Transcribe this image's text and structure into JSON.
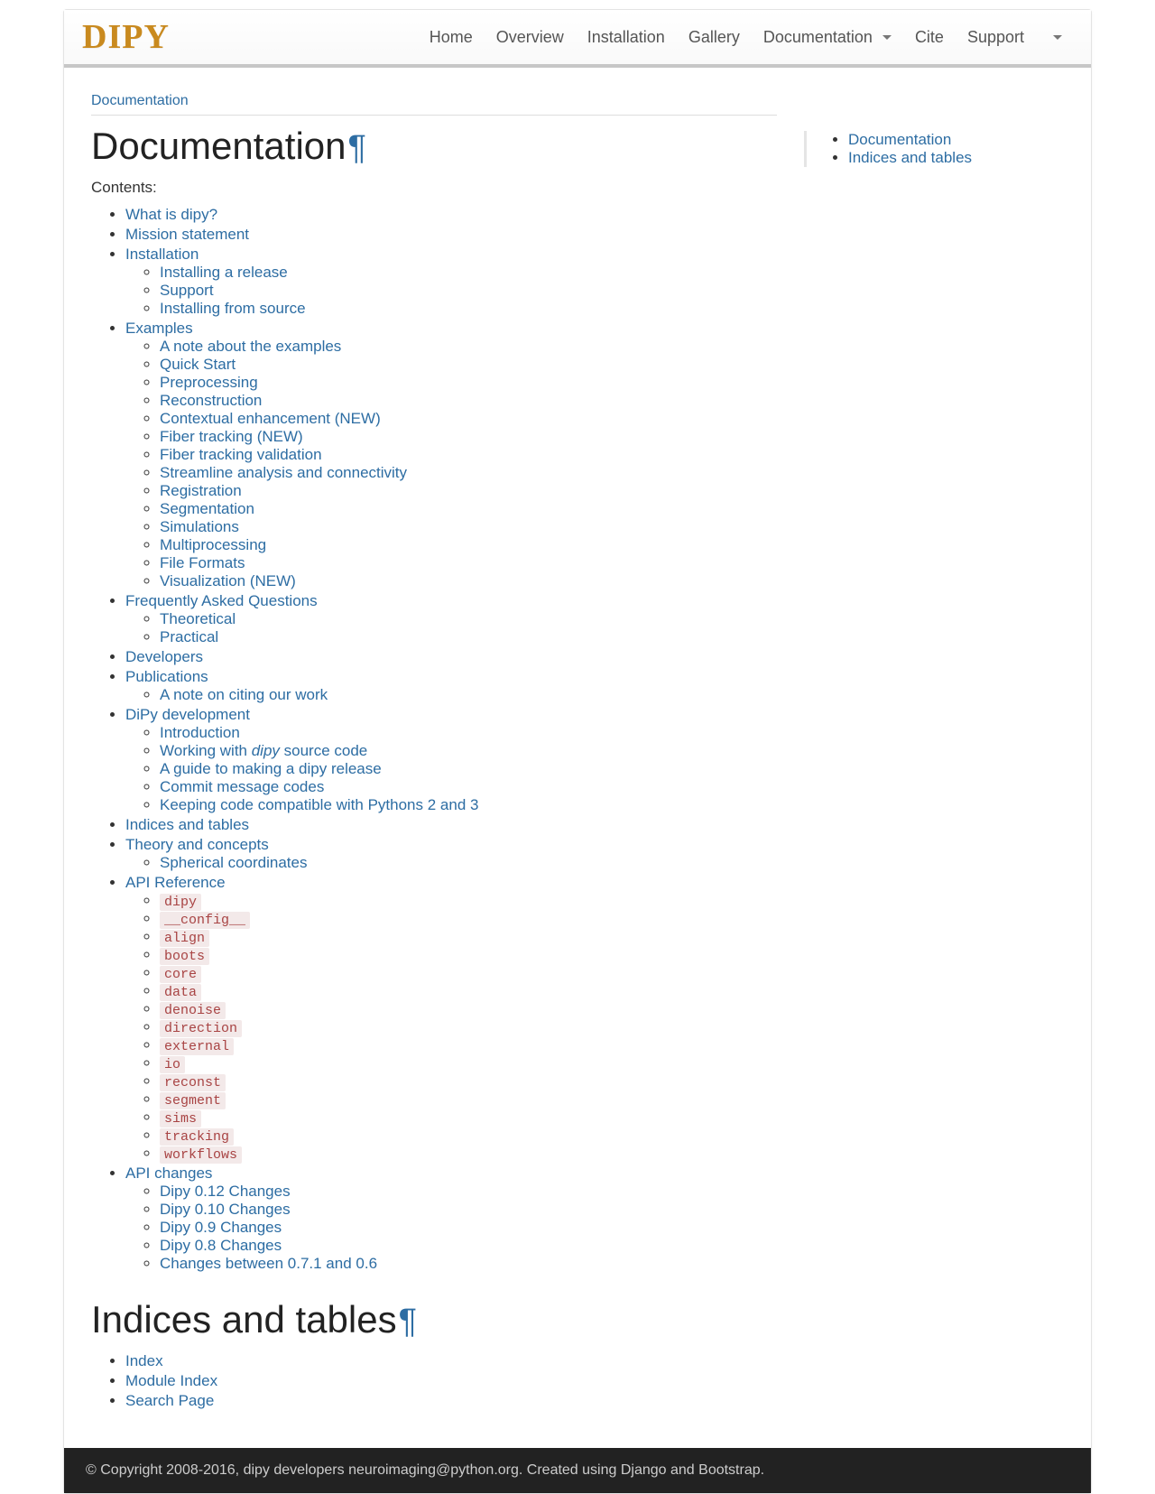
{
  "brand": "DIPY",
  "nav": {
    "home": "Home",
    "overview": "Overview",
    "installation": "Installation",
    "gallery": "Gallery",
    "documentation": "Documentation",
    "cite": "Cite",
    "support": "Support"
  },
  "breadcrumb": {
    "documentation": "Documentation"
  },
  "headings": {
    "documentation": "Documentation",
    "indices": "Indices and tables"
  },
  "contents_label": "Contents:",
  "side_nav": {
    "documentation": "Documentation",
    "indices": "Indices and tables"
  },
  "toc": {
    "what_is_dipy": "What is dipy?",
    "mission": "Mission statement",
    "installation": "Installation",
    "installation_sub": {
      "release": "Installing a release",
      "support": "Support",
      "source": "Installing from source"
    },
    "examples": "Examples",
    "examples_sub": {
      "note": "A note about the examples",
      "quickstart": "Quick Start",
      "preprocessing": "Preprocessing",
      "reconstruction": "Reconstruction",
      "contextual": "Contextual enhancement (NEW)",
      "fiber_tracking": "Fiber tracking (NEW)",
      "fiber_validation": "Fiber tracking validation",
      "streamline": "Streamline analysis and connectivity",
      "registration": "Registration",
      "segmentation": "Segmentation",
      "simulations": "Simulations",
      "multiprocessing": "Multiprocessing",
      "file_formats": "File Formats",
      "visualization": "Visualization (NEW)"
    },
    "faq": "Frequently Asked Questions",
    "faq_sub": {
      "theoretical": "Theoretical",
      "practical": "Practical"
    },
    "developers": "Developers",
    "publications": "Publications",
    "publications_sub": {
      "citing": "A note on citing our work"
    },
    "dipy_dev": "DiPy development",
    "dipy_dev_sub": {
      "intro": "Introduction",
      "working_prefix": "Working with ",
      "working_em": "dipy",
      "working_suffix": " source code",
      "release_guide": "A guide to making a dipy release",
      "commit_codes": "Commit message codes",
      "py23": "Keeping code compatible with Pythons 2 and 3"
    },
    "indices": "Indices and tables",
    "theory": "Theory and concepts",
    "theory_sub": {
      "spherical": "Spherical coordinates"
    },
    "api_ref": "API Reference",
    "api_modules": {
      "dipy": "dipy",
      "config": "__config__",
      "align": "align",
      "boots": "boots",
      "core": "core",
      "data": "data",
      "denoise": "denoise",
      "direction": "direction",
      "external": "external",
      "io": "io",
      "reconst": "reconst",
      "segment": "segment",
      "sims": "sims",
      "tracking": "tracking",
      "workflows": "workflows"
    },
    "api_changes": "API changes",
    "api_changes_sub": {
      "v012": "Dipy 0.12 Changes",
      "v010": "Dipy 0.10 Changes",
      "v09": "Dipy 0.9 Changes",
      "v08": "Dipy 0.8 Changes",
      "v07_06": "Changes between 0.7.1 and 0.6"
    }
  },
  "indices_list": {
    "index": "Index",
    "module_index": "Module Index",
    "search": "Search Page"
  },
  "footer": {
    "copyright_prefix": "© Copyright 2008-2016, dipy developers ",
    "email": "neuroimaging@python.org",
    "created_prefix": ". Created using ",
    "django": "Django",
    "and": " and ",
    "bootstrap": "Bootstrap",
    "period": "."
  }
}
